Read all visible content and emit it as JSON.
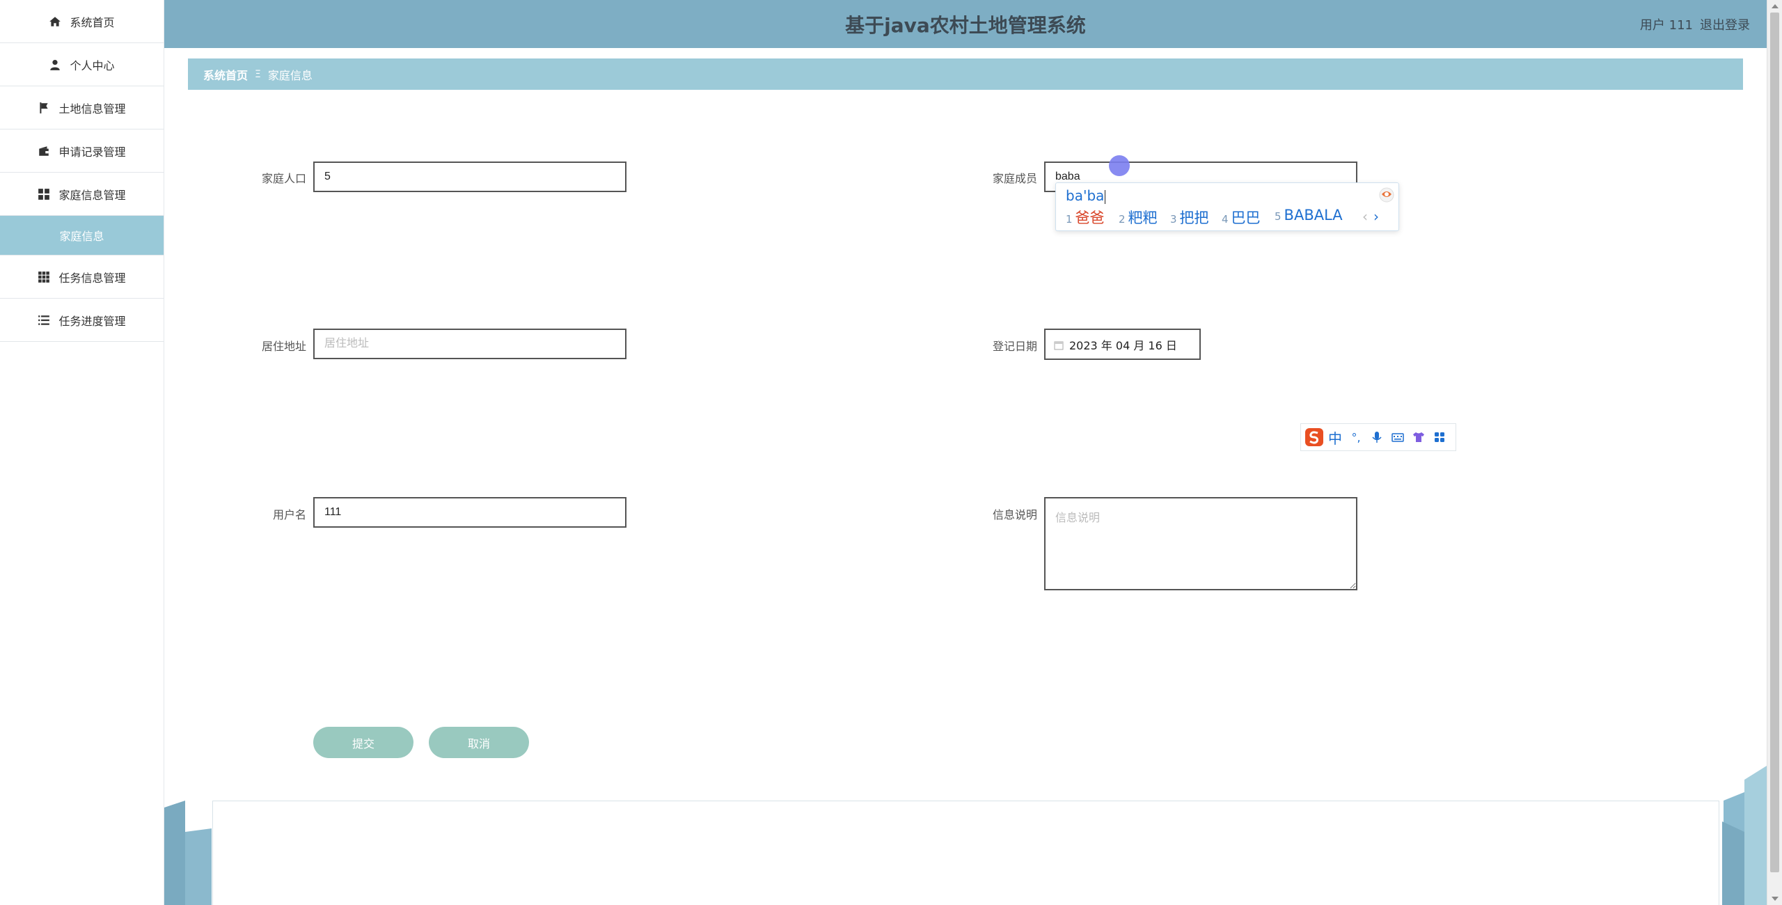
{
  "app": {
    "title": "基于java农村土地管理系统"
  },
  "header": {
    "user_label": "用户 111",
    "logout_label": "退出登录"
  },
  "sidebar": {
    "items": [
      {
        "label": "系统首页",
        "icon": "home-icon"
      },
      {
        "label": "个人中心",
        "icon": "user-icon"
      },
      {
        "label": "土地信息管理",
        "icon": "flag-icon"
      },
      {
        "label": "申请记录管理",
        "icon": "wallet-icon"
      },
      {
        "label": "家庭信息管理",
        "icon": "grid-icon"
      },
      {
        "label": "任务信息管理",
        "icon": "apps-icon"
      },
      {
        "label": "任务进度管理",
        "icon": "list-icon"
      }
    ],
    "active_sub": "家庭信息"
  },
  "breadcrumb": {
    "home": "系统首页",
    "separator": "Ξ",
    "current": "家庭信息"
  },
  "form": {
    "population": {
      "label": "家庭人口",
      "value": "5"
    },
    "members": {
      "label": "家庭成员",
      "value": "baba"
    },
    "address": {
      "label": "居住地址",
      "placeholder": "居住地址",
      "value": ""
    },
    "reg_date": {
      "label": "登记日期",
      "value": "2023 年 04 月 16 日"
    },
    "username": {
      "label": "用户名",
      "value": "111"
    },
    "description": {
      "label": "信息说明",
      "placeholder": "信息说明",
      "value": ""
    },
    "submit_label": "提交",
    "cancel_label": "取消"
  },
  "ime": {
    "composition": "ba'ba",
    "candidates": [
      {
        "num": "1",
        "text": "爸爸"
      },
      {
        "num": "2",
        "text": "粑粑"
      },
      {
        "num": "3",
        "text": "把把"
      },
      {
        "num": "4",
        "text": "巴巴"
      },
      {
        "num": "5",
        "text": "BABALA"
      }
    ],
    "prev_arrow": "‹",
    "next_arrow": "›",
    "toolbar_mode": "中",
    "toolbar_punct": "°,"
  },
  "colors": {
    "header": "#7eaec4",
    "breadcrumb": "#9ccad8",
    "button": "#99c9bf",
    "active_sub": "#99c9d8"
  }
}
